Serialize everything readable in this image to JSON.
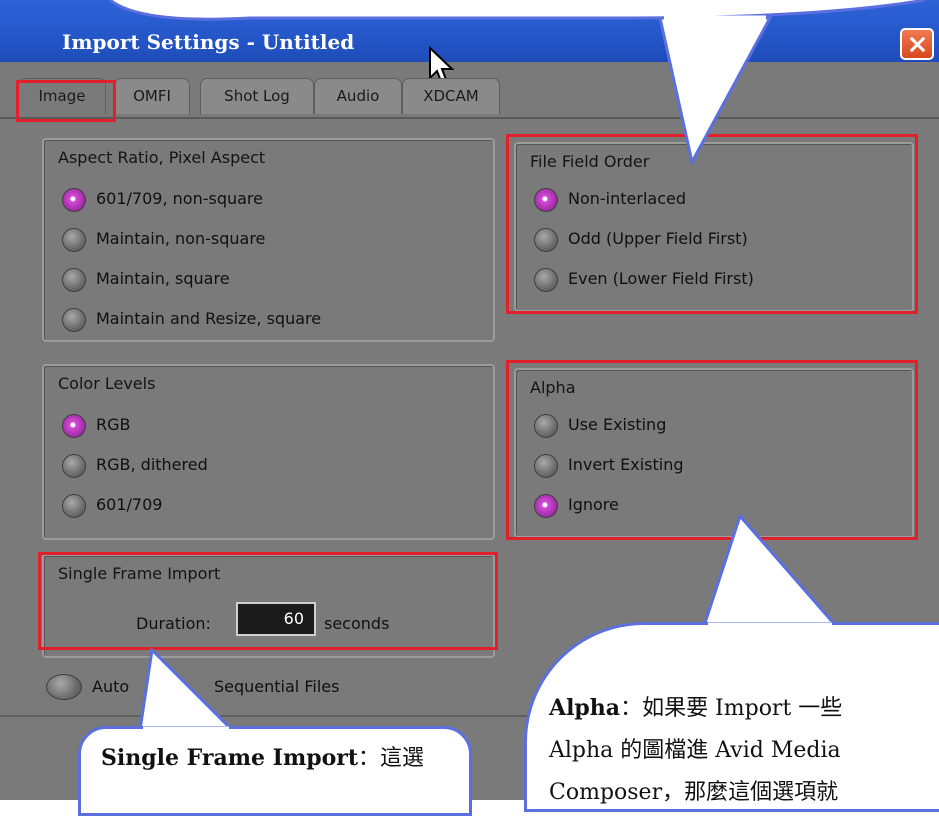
{
  "window": {
    "title": "Import Settings - Untitled"
  },
  "tabs": [
    {
      "label": "Image",
      "active": true
    },
    {
      "label": "OMFI"
    },
    {
      "label": "Shot Log"
    },
    {
      "label": "Audio"
    },
    {
      "label": "XDCAM"
    }
  ],
  "aspect": {
    "title": "Aspect Ratio, Pixel Aspect",
    "options": [
      "601/709, non-square",
      "Maintain, non-square",
      "Maintain, square",
      "Maintain and Resize, square"
    ],
    "selected": 0
  },
  "field_order": {
    "title": "File Field Order",
    "options": [
      "Non-interlaced",
      "Odd (Upper Field First)",
      "Even (Lower Field First)"
    ],
    "selected": 0
  },
  "color_levels": {
    "title": "Color Levels",
    "options": [
      "RGB",
      "RGB, dithered",
      "601/709"
    ],
    "selected": 0
  },
  "alpha": {
    "title": "Alpha",
    "options": [
      "Use Existing",
      "Invert Existing",
      "Ignore"
    ],
    "selected": 2
  },
  "single_frame": {
    "title": "Single Frame Import",
    "duration_label": "Duration:",
    "duration_value": "60",
    "units": "seconds"
  },
  "sequential": {
    "label_a": "Auto",
    "label_b": "Sequential Files"
  },
  "callouts": {
    "single_frame_term": "Single Frame Import",
    "single_frame_text": "：這選",
    "alpha_term": "Alpha",
    "alpha_line1": "：如果要 Import 一些",
    "alpha_line2": "Alpha 的圖檔進 Avid Media",
    "alpha_line3": "Composer，那麼這個選項就"
  },
  "colors": {
    "highlight": "#e0202a",
    "selected_radio": "#c13fc6",
    "callout_border": "#5b6fe0"
  }
}
